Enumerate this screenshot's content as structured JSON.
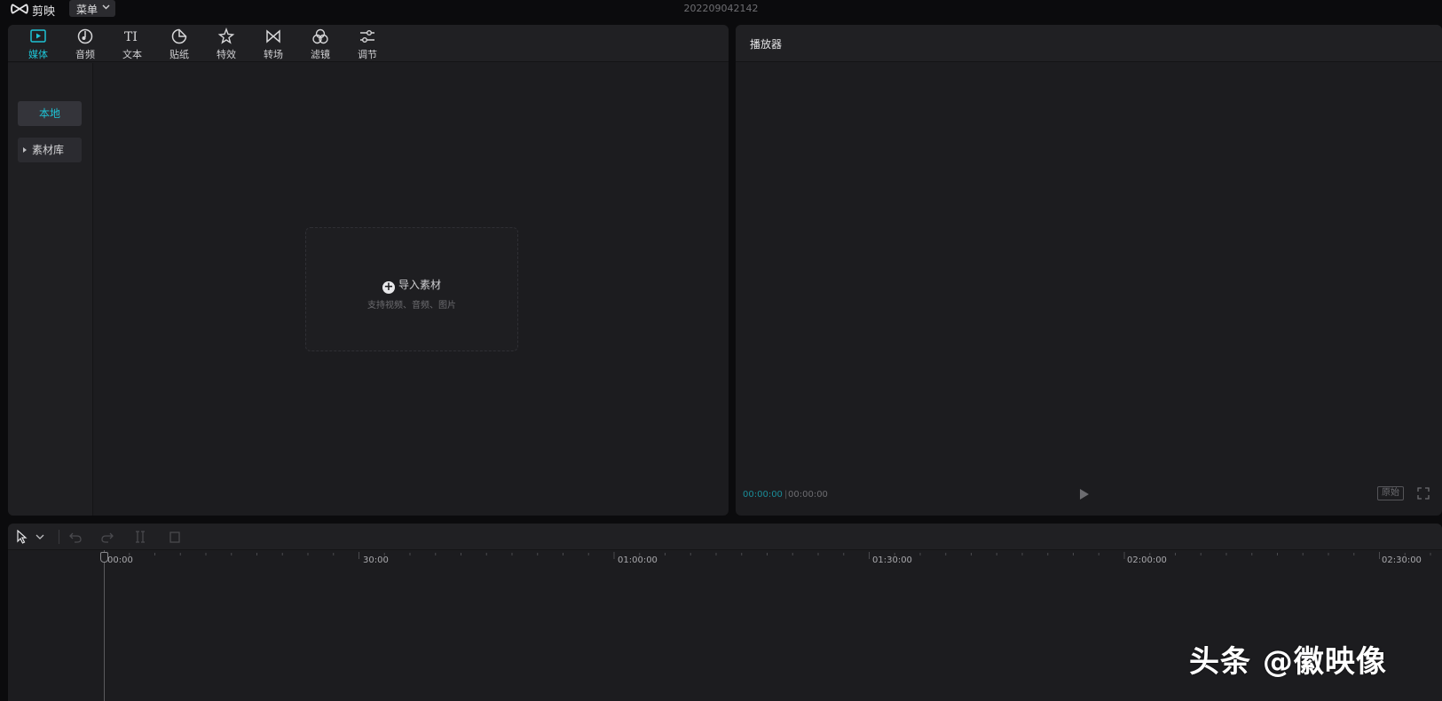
{
  "app": {
    "name": "剪映",
    "menu_label": "菜单",
    "project_title": "202209042142"
  },
  "media_panel": {
    "tabs": [
      {
        "label": "媒体",
        "icon": "media-icon",
        "active": true
      },
      {
        "label": "音频",
        "icon": "audio-icon",
        "active": false
      },
      {
        "label": "文本",
        "icon": "text-icon",
        "active": false
      },
      {
        "label": "贴纸",
        "icon": "sticker-icon",
        "active": false
      },
      {
        "label": "特效",
        "icon": "effects-icon",
        "active": false
      },
      {
        "label": "转场",
        "icon": "transition-icon",
        "active": false
      },
      {
        "label": "滤镜",
        "icon": "filter-icon",
        "active": false
      },
      {
        "label": "调节",
        "icon": "adjust-icon",
        "active": false
      }
    ],
    "sidebar": {
      "local": "本地",
      "library": "素材库"
    },
    "import": {
      "title": "导入素材",
      "subtitle": "支持视频、音频、图片"
    }
  },
  "player": {
    "title": "播放器",
    "current_time": "00:00:00",
    "total_time": "00:00:00",
    "ratio_label": "原始"
  },
  "timeline": {
    "ruler": [
      "00:00",
      "30:00",
      "01:00:00",
      "01:30:00",
      "02:00:00",
      "02:30:00"
    ]
  },
  "watermark": "头条 @徽映像",
  "colors": {
    "accent": "#1ec3d5",
    "panel": "#1c1c1f",
    "background": "#0b0b0d"
  }
}
